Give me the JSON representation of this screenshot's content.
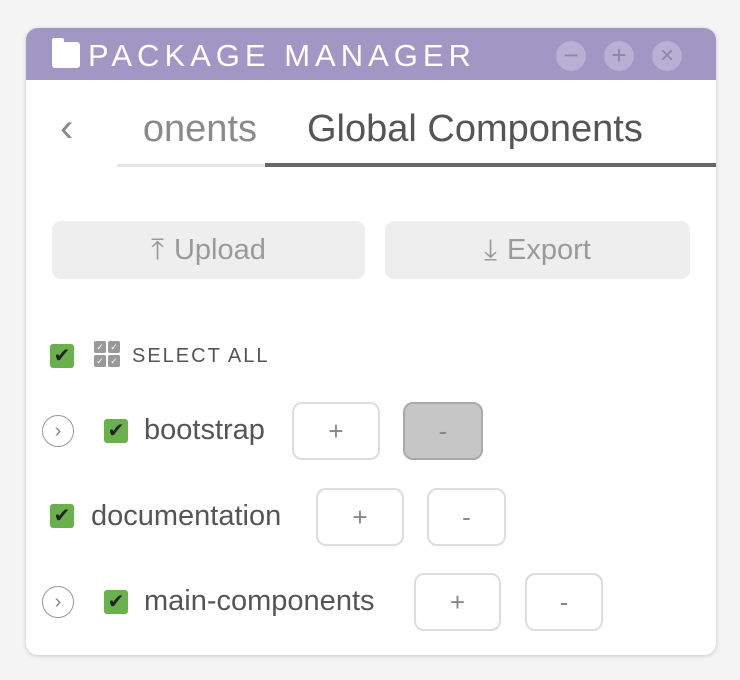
{
  "window": {
    "title": "PACKAGE MANAGER",
    "controls": [
      "minimize",
      "maximize",
      "close"
    ],
    "accent": "#a097c4"
  },
  "tabs": {
    "back_icon": "chevron-left-icon",
    "items": [
      {
        "label": "Components",
        "visible_text": "onents",
        "active": false
      },
      {
        "label": "Global Components",
        "active": true
      }
    ]
  },
  "actions": {
    "upload": "Upload",
    "export": "Export"
  },
  "select_all": {
    "label": "SELECT ALL",
    "checked": true
  },
  "packages": [
    {
      "name": "bootstrap",
      "checked": true,
      "expandable": true,
      "plus": "+",
      "minus": "-",
      "minus_pressed": true
    },
    {
      "name": "documentation",
      "checked": true,
      "expandable": false,
      "plus": "+",
      "minus": "-",
      "minus_pressed": false
    },
    {
      "name": "main-components",
      "checked": true,
      "expandable": true,
      "plus": "+",
      "minus": "-",
      "minus_pressed": false
    }
  ],
  "icons": {
    "check": "✔",
    "chevron_right": "›",
    "chevron_left": "‹",
    "minimize": "−",
    "maximize": "+",
    "close": "×",
    "upload": "⤒",
    "export": "⤓"
  }
}
